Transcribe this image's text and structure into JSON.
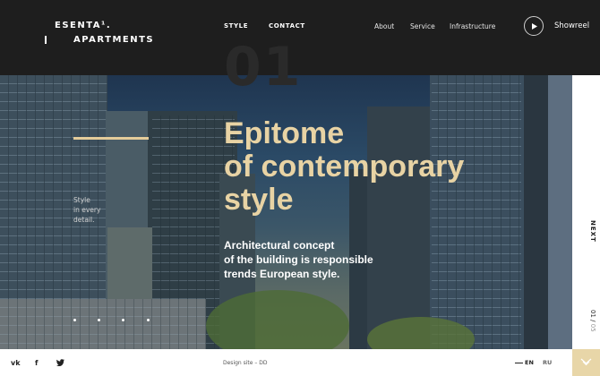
{
  "logo": {
    "line1": "ESENTA¹.",
    "line2": "APARTMENTS"
  },
  "nav": {
    "main": [
      "STYLE",
      "CONTACT"
    ],
    "secondary": [
      "About",
      "Service",
      "Infrastructure"
    ],
    "showreel": "Showreel"
  },
  "hero": {
    "slide_number": "01",
    "headline": [
      "Epitome",
      "of contemporary",
      "style"
    ],
    "subtitle": [
      "Architectural concept",
      "of the building is responsible",
      "trends European style."
    ],
    "side_note": [
      "Style",
      "in every",
      "detail."
    ],
    "dots": 4
  },
  "slider": {
    "next_label": "NEXT",
    "current": "01",
    "total": "05"
  },
  "footer": {
    "social": [
      "vk",
      "f",
      "twitter"
    ],
    "credit": "Design site – DD",
    "languages": [
      "EN",
      "RU"
    ],
    "active_language": "EN"
  },
  "colors": {
    "accent": "#e4cc9a",
    "headline": "#e8d3a4",
    "header_bg": "#1e1e1e",
    "corner_bg": "#e8d6a8"
  }
}
